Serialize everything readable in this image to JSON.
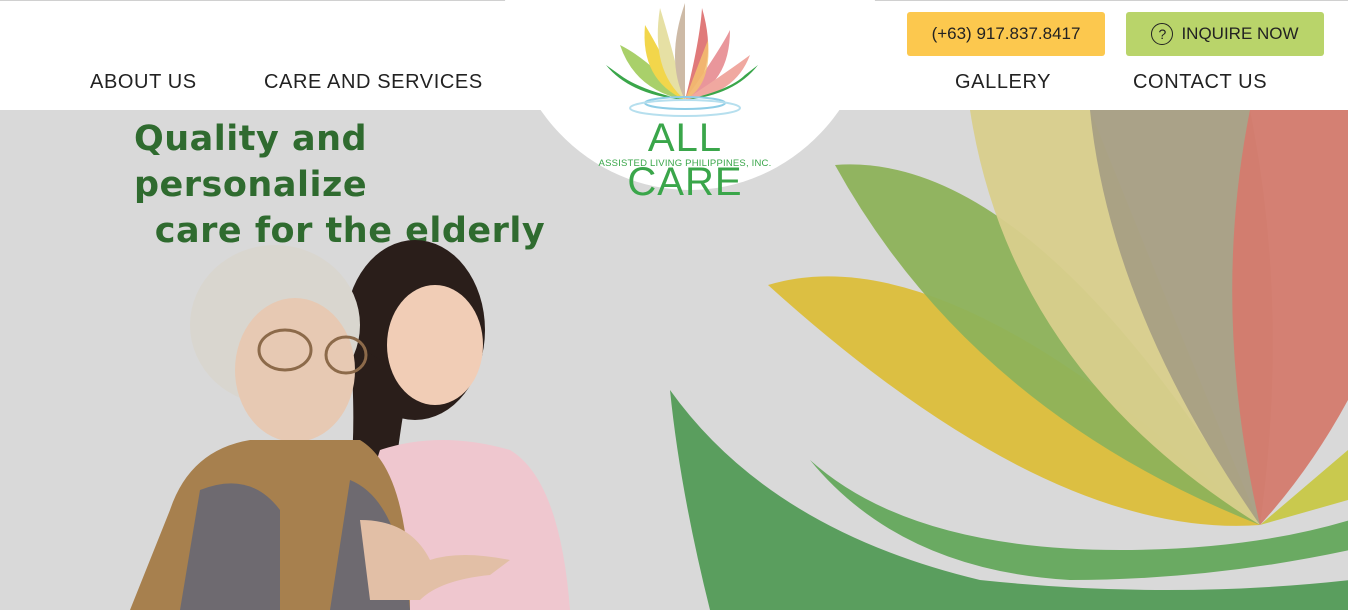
{
  "nav": {
    "left": [
      {
        "label": "ABOUT US"
      },
      {
        "label": "CARE AND SERVICES"
      }
    ],
    "right": [
      {
        "label": "GALLERY"
      },
      {
        "label": "CONTACT US"
      }
    ]
  },
  "buttons": {
    "phone_label": "(+63) 917.837.8417",
    "inquire_label": "INQUIRE NOW",
    "inquire_icon": "question-circle-icon"
  },
  "logo": {
    "name": "ALL CARE",
    "subtitle": "ASSISTED LIVING PHILIPPINES, INC."
  },
  "hero": {
    "title_line1": "Quality and personalize",
    "title_line2": "care for the elderly"
  },
  "colors": {
    "phone_button": "#fcc84e",
    "inquire_button": "#b9d46a",
    "brand_green": "#3aa64a",
    "hero_bg": "#d9d9d9"
  }
}
